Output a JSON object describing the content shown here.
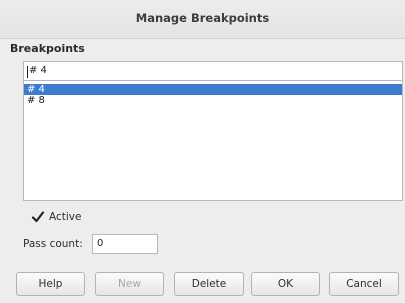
{
  "dialog": {
    "title": "Manage Breakpoints"
  },
  "breakpoints": {
    "label": "Breakpoints",
    "entry_value": "# 4",
    "items": [
      {
        "label": "# 4",
        "selected": true
      },
      {
        "label": "# 8",
        "selected": false
      }
    ]
  },
  "active": {
    "label": "Active",
    "checked": true
  },
  "pass_count": {
    "label": "Pass count:",
    "value": "0"
  },
  "buttons": {
    "help": "Help",
    "new": "New",
    "delete": "Delete",
    "ok": "OK",
    "cancel": "Cancel"
  },
  "colors": {
    "selection": "#3d7bcc",
    "background": "#ededed"
  },
  "icons": {
    "checkbox": "checkmark-icon"
  }
}
